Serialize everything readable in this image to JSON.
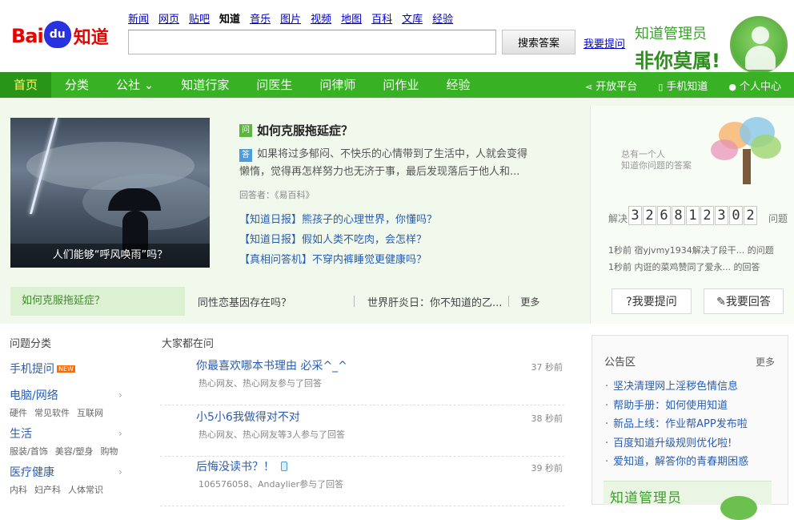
{
  "header": {
    "logo_bai": "Bai",
    "logo_du": "du",
    "logo_zd": "知道",
    "topnav": [
      "新闻",
      "网页",
      "贴吧",
      "知道",
      "音乐",
      "图片",
      "视频",
      "地图",
      "百科",
      "文库",
      "经验"
    ],
    "search_value": "",
    "search_button": "搜索答案",
    "ask_link": "我要提问",
    "promo_line1": "知道管理员",
    "promo_line2": "非你莫属!"
  },
  "green_nav": {
    "items": [
      "首页",
      "分类",
      "公社 ⌄",
      "知道行家",
      "问医生",
      "问律师",
      "问作业",
      "经验"
    ],
    "right": [
      "开放平台",
      "手机知道",
      "个人中心"
    ]
  },
  "hero": {
    "image_caption": "人们能够“呼风唤雨”吗？",
    "q_tag": "问",
    "q_title": "如何克服拖延症？",
    "a_tag": "答",
    "q_desc": "如果将过多郁闷、不快乐的心情带到了生活中，人就会变得懒惰，觉得再怎样努力也无济于事，最后发现落后于他人和...",
    "q_src": "回答者：《易百科》",
    "daily": [
      "【知道日报】熊孩子的心理世界，你懂吗？",
      "【知道日报】假如人类不吃肉，会怎样？",
      "【真相问答机】不穿内裤睡觉更健康吗？"
    ],
    "bar2_current": "如何克服拖延症？",
    "bar2_items": [
      "同性恋基因存在吗？",
      "世界肝炎日：你不知道的乙..."
    ],
    "bar2_more": "更多"
  },
  "hero_right": {
    "line1": "总有一个人",
    "line2": "知道你问题的答案",
    "counter_label_left": "解决",
    "counter_digits": [
      "3",
      "2",
      "6",
      "8",
      "1",
      "2",
      "3",
      "0",
      "2"
    ],
    "counter_label_right": "问题",
    "recent": [
      "1秒前 宿yjvmy1934解决了段干... 的问题",
      "1秒前 内诳的菜鸡赞同了爱永... 的回答"
    ],
    "ask_btn": "?我要提问",
    "answer_btn": "✎我要回答"
  },
  "categories": {
    "head": "问题分类",
    "mobile": "手机提问",
    "new_badge": "NEW",
    "items": [
      {
        "title": "电脑/网络",
        "subs": [
          "硬件",
          "常见软件",
          "互联网"
        ]
      },
      {
        "title": "生活",
        "subs": [
          "服装/首饰",
          "美容/塑身",
          "购物"
        ]
      },
      {
        "title": "医疗健康",
        "subs": [
          "内科",
          "妇产科",
          "人体常识"
        ]
      }
    ]
  },
  "asking": {
    "head": "大家都在问",
    "rows": [
      {
        "title": "你最喜欢哪本书理由 必采^_^",
        "meta": "热心网友、热心网友参与了回答",
        "time": "37 秒前"
      },
      {
        "title": "小5小6我做得对不对",
        "meta": "热心网友、热心网友等3人参与了回答",
        "time": "38 秒前"
      },
      {
        "title": "后悔没读书？！",
        "meta": "106576058、Andaylier参与了回答",
        "time": "39 秒前"
      }
    ]
  },
  "notice": {
    "head": "公告区",
    "more": "更多",
    "items": [
      "坚决清理网上淫秽色情信息",
      "帮助手册：如何使用知道",
      "新品上线：作业帮APP发布啦",
      "百度知道升级规则优化啦!",
      "爱知道，解答你的青春期困惑"
    ]
  },
  "bottom_promo": "知道管理员",
  "colors": {
    "brand_green": "#38b224",
    "link_blue": "#2a5db0",
    "baidu_red": "#e10602",
    "baidu_blue": "#2932e1"
  }
}
